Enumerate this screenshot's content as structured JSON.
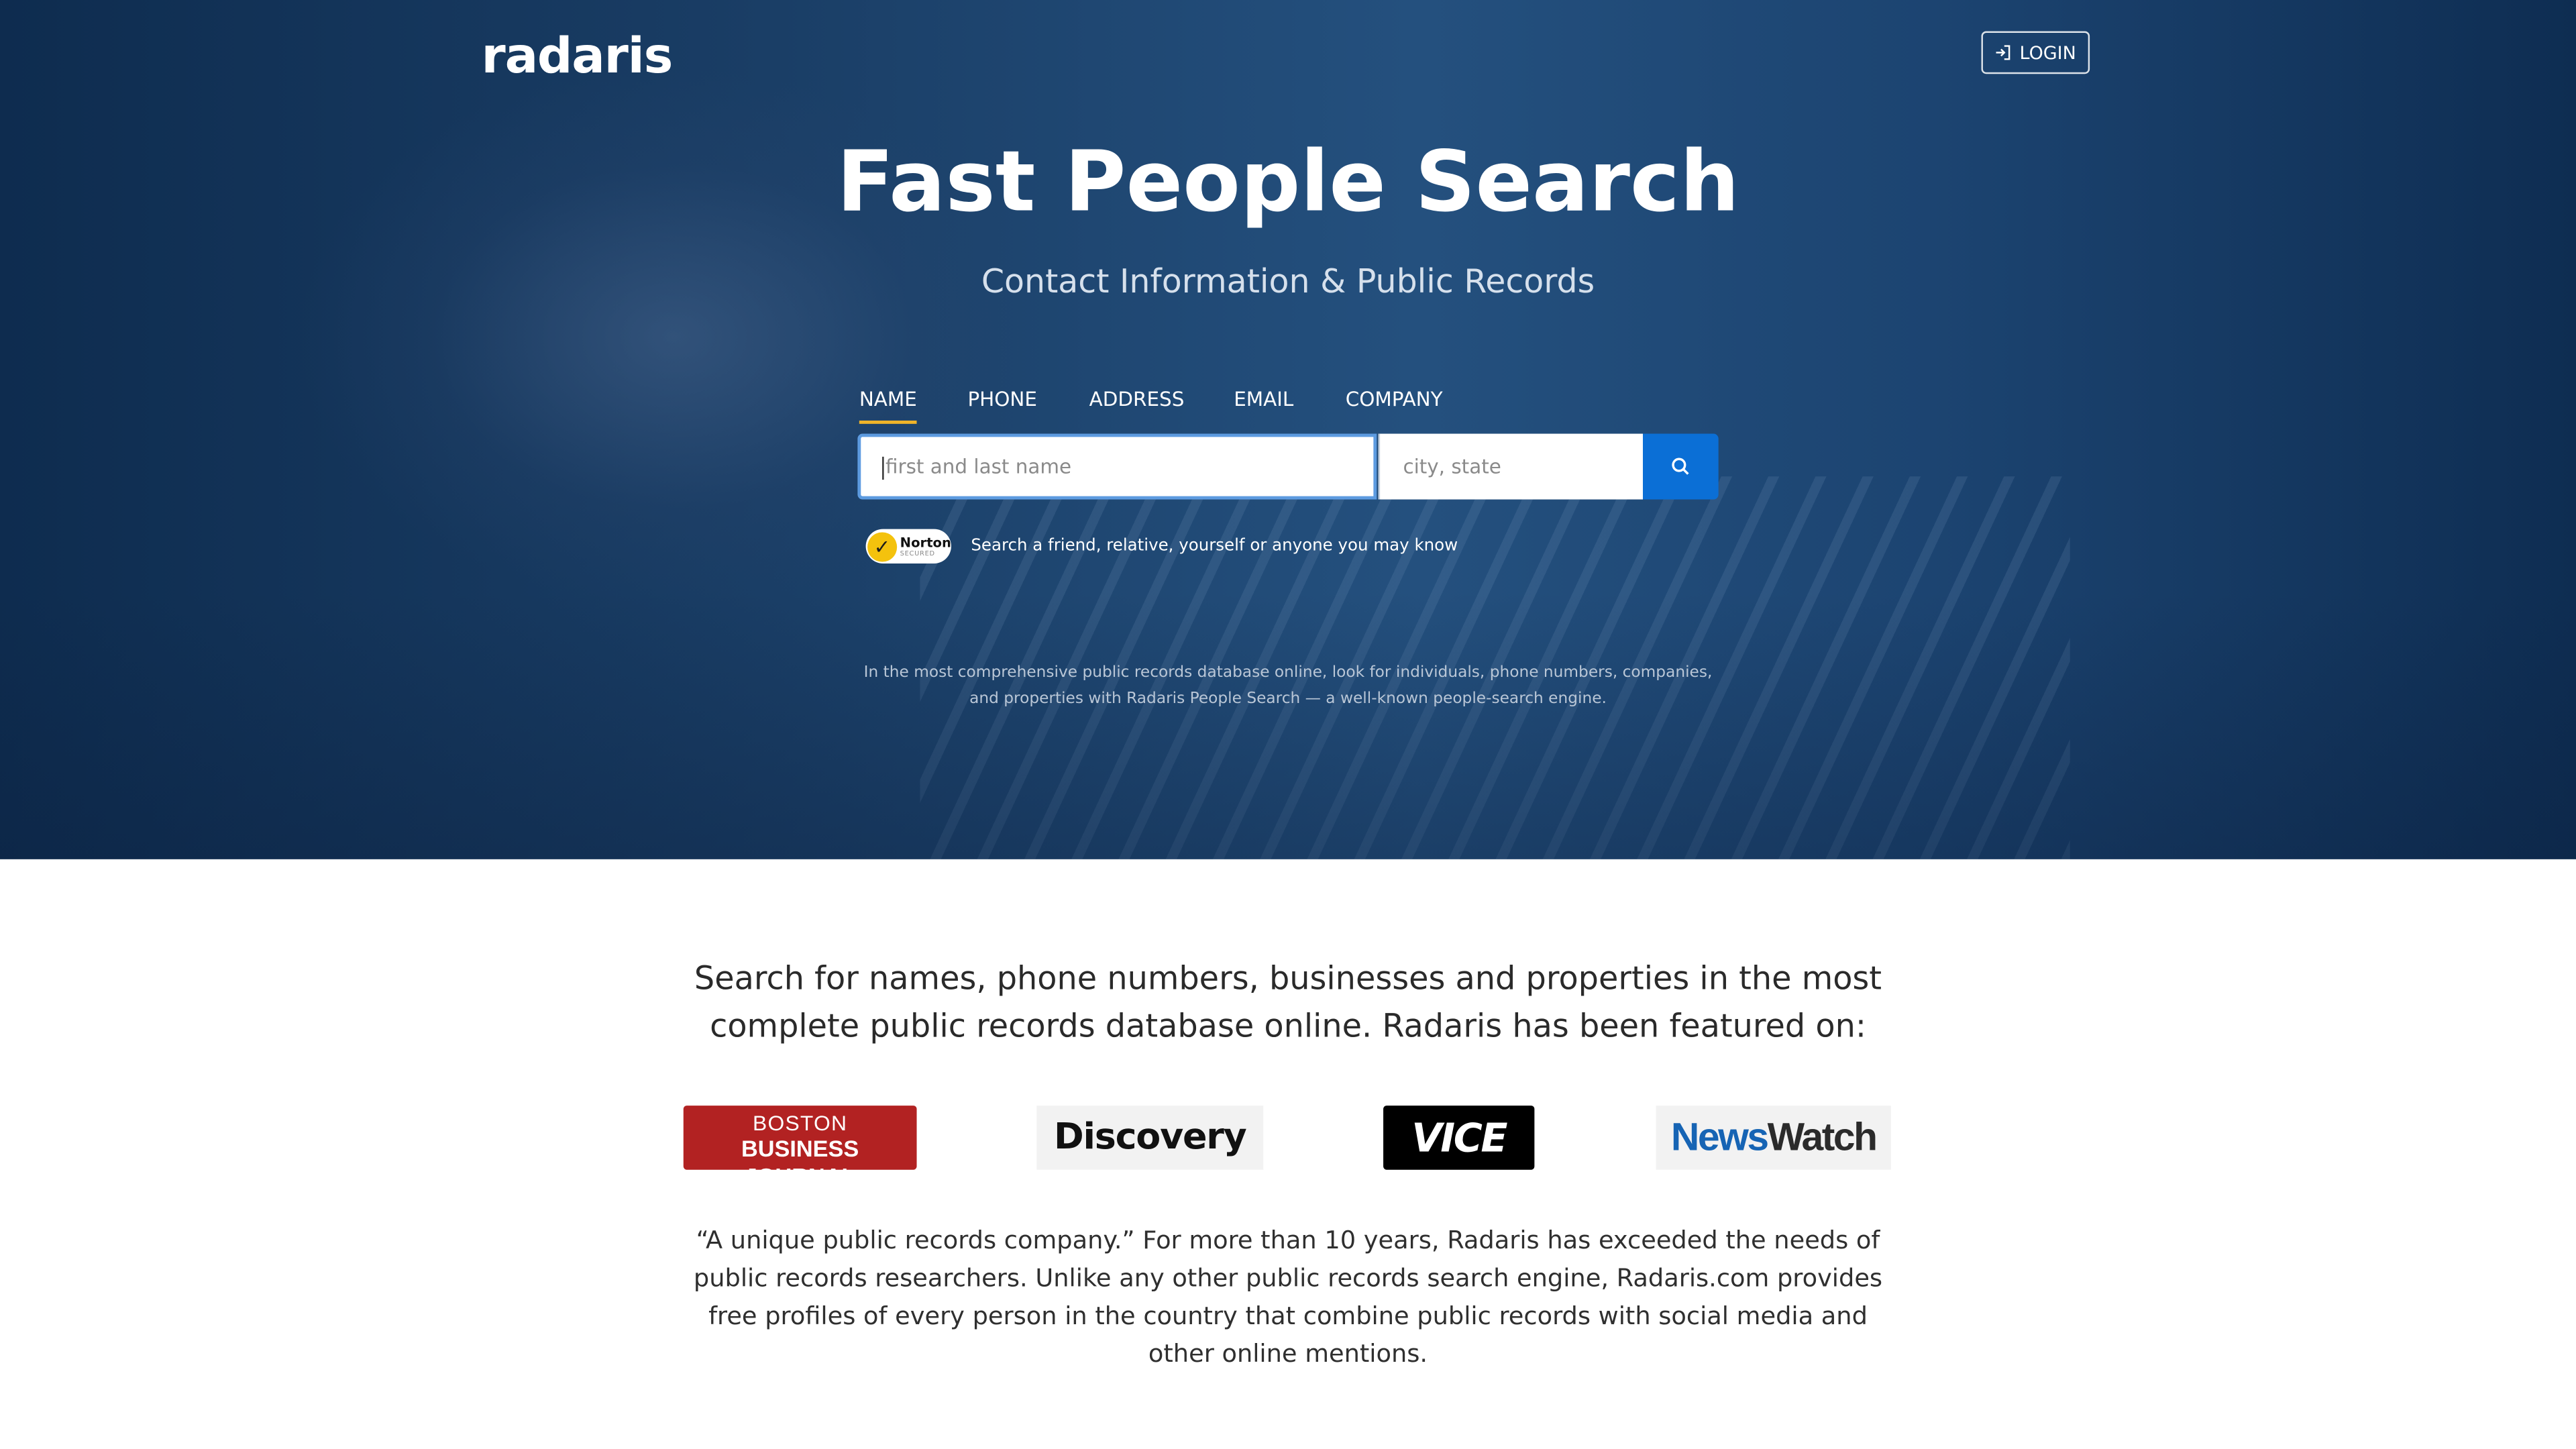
{
  "header": {
    "logo_text": "radaris",
    "login_label": "LOGIN"
  },
  "hero": {
    "title": "Fast People Search",
    "subtitle": "Contact Information & Public Records",
    "tabs": [
      {
        "label": "NAME",
        "active": true
      },
      {
        "label": "PHONE",
        "active": false
      },
      {
        "label": "ADDRESS",
        "active": false
      },
      {
        "label": "EMAIL",
        "active": false
      },
      {
        "label": "COMPANY",
        "active": false
      }
    ],
    "search": {
      "name_placeholder": "first and last name",
      "location_placeholder": "city, state",
      "button_icon": "search-icon"
    },
    "norton_badge": {
      "line1": "Norton",
      "line2": "SECURED"
    },
    "hint": "Search a friend, relative, yourself or anyone you may know",
    "description": "In the most comprehensive public records database online, look for individuals, phone numbers, companies, and properties with Radaris People Search — a well-known people-search engine."
  },
  "featured": {
    "lead": "Search for names, phone numbers, businesses and properties in the most complete public records database online. Radaris has been featured on:",
    "logos": {
      "bbj_line1": "BOSTON",
      "bbj_line2": "BUSINESS JOURNAL",
      "discovery": "Discovery",
      "vice": "VICE",
      "newswatch_part1": "News",
      "newswatch_part2": "Watch"
    },
    "quote": "“A unique public records company.” For more than 10 years, Radaris has exceeded the needs of public records researchers. Unlike any other public records search engine, Radaris.com provides free profiles of every person in the country that combine public records with social media and other online mentions."
  },
  "colors": {
    "hero_bg": "#1a3e66",
    "accent_tab_underline": "#f0b429",
    "search_button": "#0b6fd6",
    "bbj_red": "#b22222",
    "newswatch_blue": "#1664b4"
  }
}
